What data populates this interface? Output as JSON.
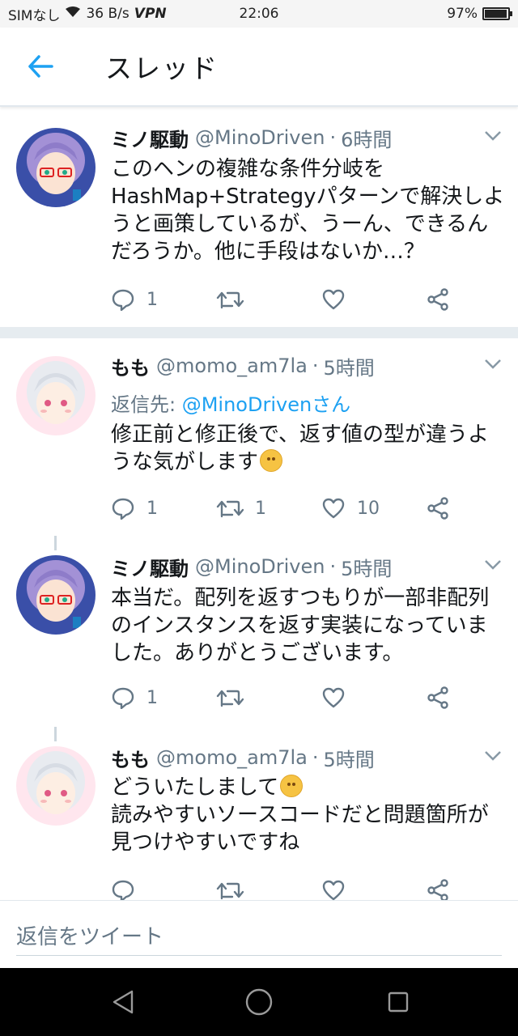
{
  "status_bar": {
    "carrier": "SIMなし",
    "speed": "36 B/s",
    "vpn": "VPN",
    "time": "22:06",
    "battery": "97%",
    "battery_level": 0.97
  },
  "header": {
    "title": "スレッド",
    "back_icon": "arrow-left-icon"
  },
  "colors": {
    "accent": "#1da1f2",
    "text": "#14171a",
    "muted": "#657786",
    "divider": "#e6ecf0"
  },
  "tweets": [
    {
      "name": "ミノ駆動",
      "handle": "@MinoDriven",
      "dot": "·",
      "time": "6時間",
      "avatar": "avatar-purple-hair-glasses",
      "text_lines": [
        "このヘンの複雑な条件分岐を",
        "HashMap+Strategyパターンで解決しよ",
        "うと画策しているが、うーん、できるん",
        "だろうか。他に手段はないか…？"
      ],
      "reply_count": "1",
      "retweet_count": "",
      "like_count": ""
    },
    {
      "name": "もも",
      "handle": "@momo_am7la",
      "dot": "·",
      "time": "5時間",
      "avatar": "avatar-white-hair",
      "reply_to_prefix": "返信先: ",
      "reply_to_user": "@MinoDrivenさん",
      "text_lines": [
        "修正前と修正後で、返す値の型が違うよ",
        "うな気がします"
      ],
      "emoji": "thinking-face",
      "reply_count": "1",
      "retweet_count": "1",
      "like_count": "10"
    },
    {
      "name": "ミノ駆動",
      "handle": "@MinoDriven",
      "dot": "·",
      "time": "5時間",
      "avatar": "avatar-purple-hair-glasses",
      "text_lines": [
        "本当だ。配列を返すつもりが一部非配列",
        "のインスタンスを返す実装になっていま",
        "した。ありがとうございます。"
      ],
      "reply_count": "1",
      "retweet_count": "",
      "like_count": ""
    },
    {
      "name": "もも",
      "handle": "@momo_am7la",
      "dot": "·",
      "time": "5時間",
      "avatar": "avatar-white-hair",
      "text_lines": [
        "どういたしまして",
        "読みやすいソースコードだと問題箇所が",
        "見つけやすいですね"
      ],
      "emoji": "relieved-face",
      "reply_count": "",
      "retweet_count": "",
      "like_count": ""
    }
  ],
  "reply_bar": {
    "placeholder": "返信をツイート"
  },
  "nav_bar": {
    "back": "triangle-back-icon",
    "home": "circle-home-icon",
    "recents": "square-recents-icon"
  }
}
